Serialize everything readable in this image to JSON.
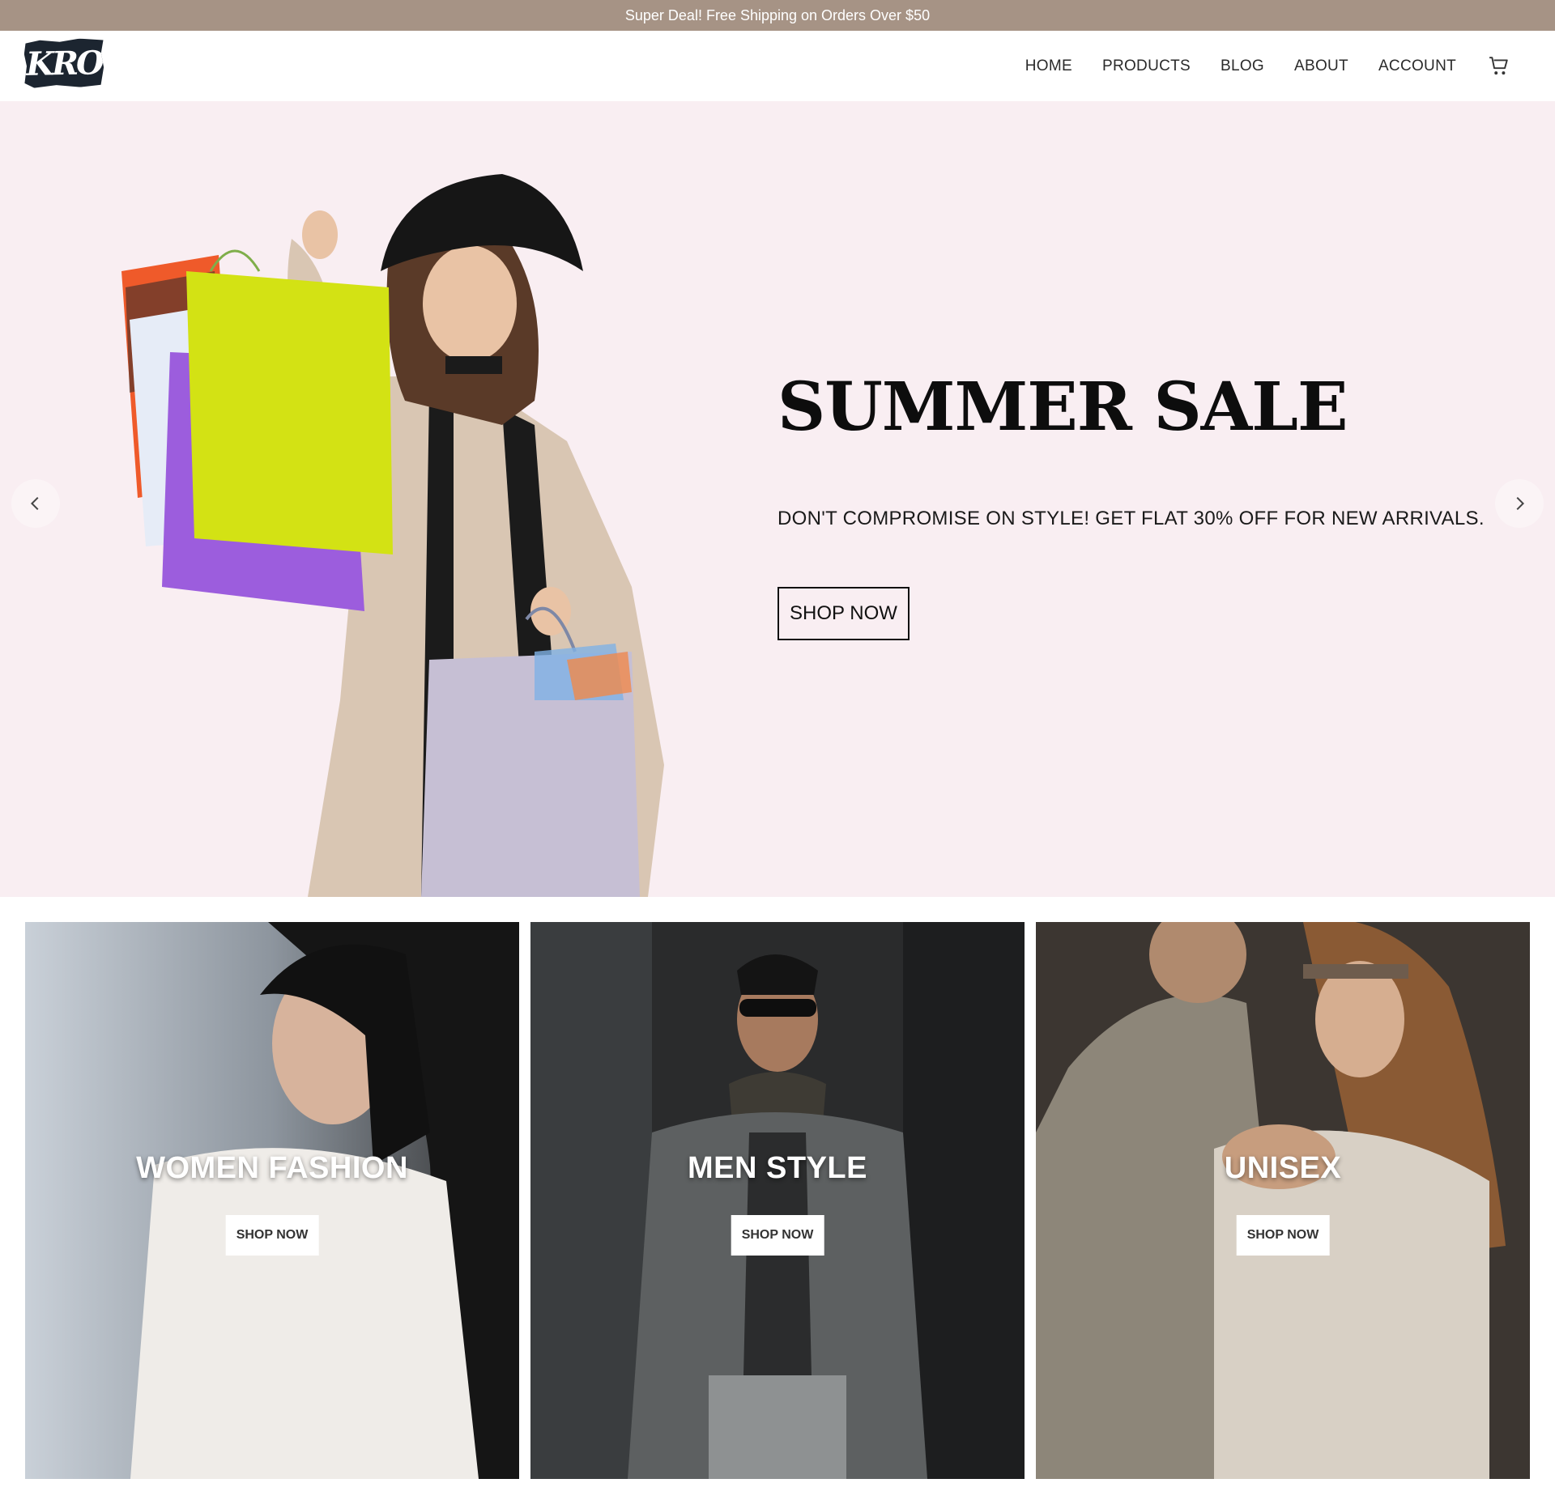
{
  "announcement": {
    "text": "Super Deal! Free Shipping on Orders Over $50"
  },
  "header": {
    "logo_text": "KRO",
    "nav": [
      "HOME",
      "PRODUCTS",
      "BLOG",
      "ABOUT",
      "ACCOUNT"
    ],
    "cart_icon": "cart-icon"
  },
  "hero": {
    "title": "SUMMER SALE",
    "subtitle": "DON'T COMPROMISE ON STYLE! GET FLAT 30% OFF FOR NEW ARRIVALS.",
    "button": "SHOP NOW",
    "prev_icon": "chevron-left-icon",
    "next_icon": "chevron-right-icon"
  },
  "categories": [
    {
      "title": "WOMEN FASHION",
      "button": "SHOP NOW"
    },
    {
      "title": "MEN STYLE",
      "button": "SHOP NOW"
    },
    {
      "title": "UNISEX",
      "button": "SHOP NOW"
    }
  ],
  "colors": {
    "announcement_bg": "#a69385",
    "hero_bg": "#f9eef2",
    "text_dark": "#111111"
  }
}
